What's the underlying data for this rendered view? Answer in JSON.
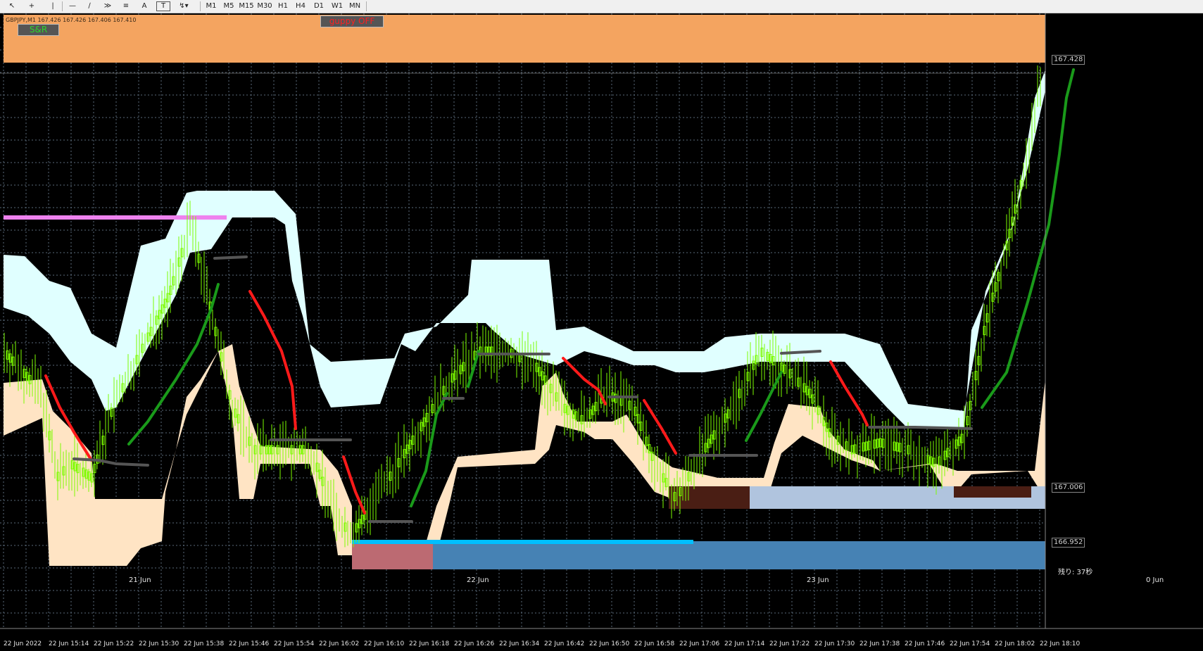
{
  "toolbar": {
    "timeframes": [
      "M1",
      "M5",
      "M15",
      "M30",
      "H1",
      "H4",
      "D1",
      "W1",
      "MN"
    ],
    "text_tool": "A",
    "textlabel_tool": "T"
  },
  "chart": {
    "symbol_header": "GBPJPY,M1  167.426 167.426 167.406 167.410",
    "sr_button": "S&R",
    "guppy_button": "guppy OFF",
    "price_labels": [
      "167.428",
      "167.006",
      "166.952"
    ],
    "remaining_label": "残り: 37秒",
    "date_markers": [
      "21 Jun",
      "22 Jun",
      "23 Jun",
      "0 Jun"
    ],
    "time_labels": [
      "22 Jun 2022",
      "22 Jun 15:14",
      "22 Jun 15:22",
      "22 Jun 15:30",
      "22 Jun 15:38",
      "22 Jun 15:46",
      "22 Jun 15:54",
      "22 Jun 16:02",
      "22 Jun 16:10",
      "22 Jun 16:18",
      "22 Jun 16:26",
      "22 Jun 16:34",
      "22 Jun 16:42",
      "22 Jun 16:50",
      "22 Jun 16:58",
      "22 Jun 17:06",
      "22 Jun 17:14",
      "22 Jun 17:22",
      "22 Jun 17:30",
      "22 Jun 17:38",
      "22 Jun 17:46",
      "22 Jun 17:54",
      "22 Jun 18:02",
      "22 Jun 18:10"
    ],
    "colors": {
      "background": "#000000",
      "grid": "#5a6a7a",
      "resistance_zone": "#f4a460",
      "upper_cloud": "#e0ffff",
      "lower_cloud": "#ffe4c4",
      "candles": "#7cfc00",
      "ma_up": "#1a9a1a",
      "ma_down": "#ff1a1a",
      "ma_flat": "#555555",
      "magenta_line": "#ee82ee",
      "blue_line": "#00bfff",
      "support_zone": "#4682b4",
      "support_zone_light": "#b0c4de",
      "dark_zone": "#4a1e14",
      "pink_zone": "#bc6a72"
    }
  }
}
